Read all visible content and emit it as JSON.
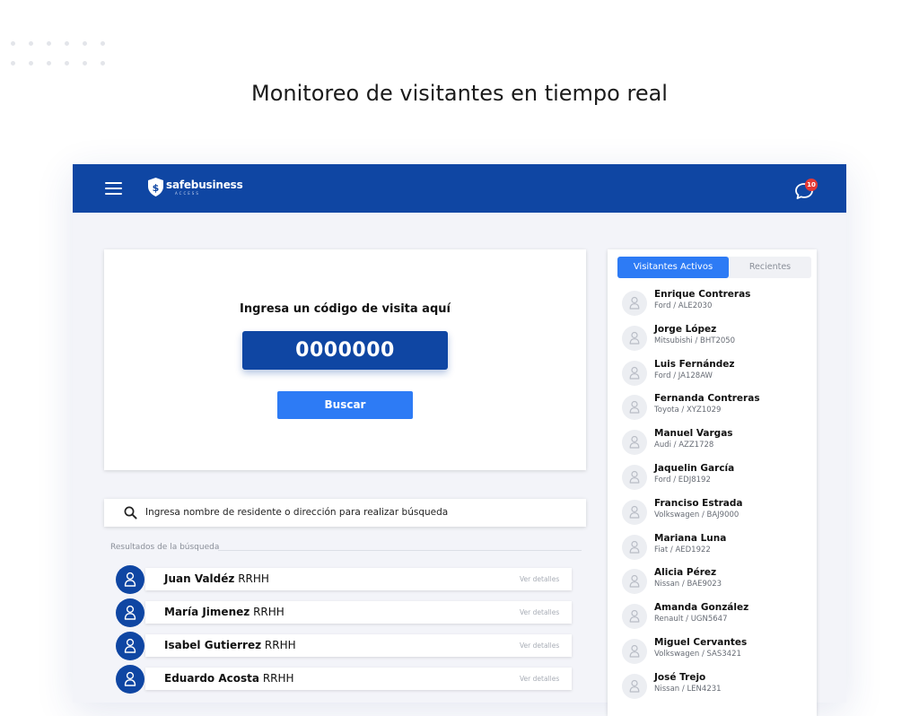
{
  "hero": {
    "title": "Monitoreo de visitantes en tiempo real"
  },
  "header": {
    "brand": "safebusiness",
    "brand_sub": "ACCESS",
    "notification_count": "10"
  },
  "code_panel": {
    "label": "Ingresa un código de visita aquí",
    "code_value": "0000000",
    "button_label": "Buscar"
  },
  "resident_search": {
    "placeholder": "Ingresa nombre de residente o dirección para realizar búsqueda"
  },
  "results": {
    "label": "Resultados de la búsqueda",
    "rows": [
      {
        "name": "Juan Valdéz",
        "dept": "RRHH",
        "action": "Ver detalles"
      },
      {
        "name": "María Jimenez",
        "dept": "RRHH",
        "action": "Ver detalles"
      },
      {
        "name": "Isabel Gutierrez",
        "dept": "RRHH",
        "action": "Ver detalles"
      },
      {
        "name": "Eduardo Acosta",
        "dept": "RRHH",
        "action": "Ver detalles"
      }
    ]
  },
  "visitors": {
    "tabs": {
      "active": "Visitantes Activos",
      "inactive": "Recientes"
    },
    "items": [
      {
        "name": "Enrique Contreras",
        "car": "Ford / ALE2030"
      },
      {
        "name": "Jorge López",
        "car": "Mitsubishi / BHT2050"
      },
      {
        "name": "Luis Fernández",
        "car": "Ford / JA128AW"
      },
      {
        "name": "Fernanda Contreras",
        "car": "Toyota / XYZ1029"
      },
      {
        "name": "Manuel Vargas",
        "car": "Audi / AZZ1728"
      },
      {
        "name": "Jaquelin García",
        "car": "Ford / EDJ8192"
      },
      {
        "name": "Franciso Estrada",
        "car": "Volkswagen / BAJ9000"
      },
      {
        "name": "Mariana Luna",
        "car": "Fiat / AED1922"
      },
      {
        "name": "Alicia Pérez",
        "car": "Nissan / BAE9023"
      },
      {
        "name": "Amanda González",
        "car": "Renault / UGN5647"
      },
      {
        "name": "Miguel Cervantes",
        "car": "Volkswagen / SAS3421"
      },
      {
        "name": "José Trejo",
        "car": "Nissan / LEN4231"
      }
    ]
  },
  "colors": {
    "primary": "#0f46a3",
    "accent": "#2d7bf5",
    "badge": "#e53935"
  }
}
